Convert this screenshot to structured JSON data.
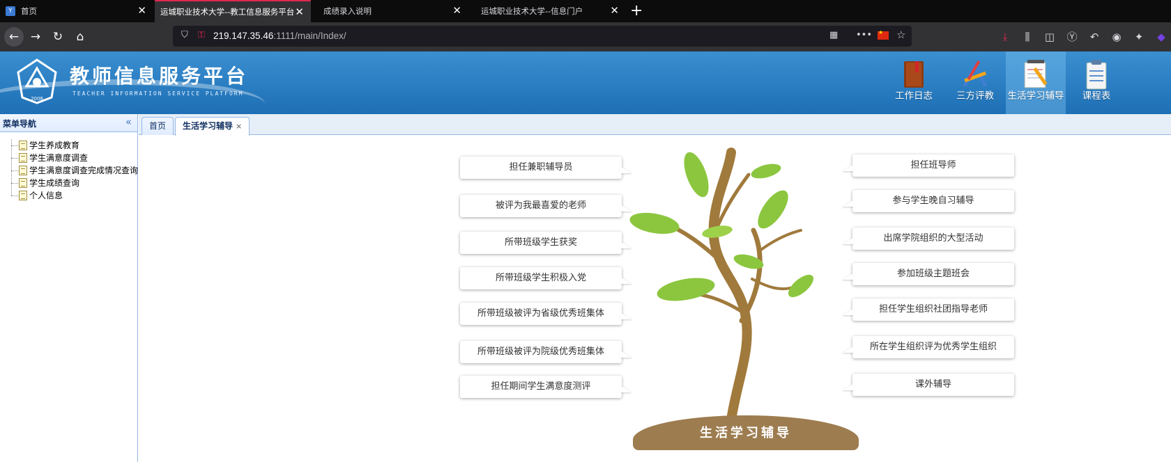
{
  "browser": {
    "tabs": [
      {
        "label": "首页",
        "active": false
      },
      {
        "label": "运城职业技术大学--教工信息服务平台",
        "active": true
      },
      {
        "label": "成绩录入说明",
        "active": false
      },
      {
        "label": "运城职业技术大学--信息门户",
        "active": false
      }
    ],
    "url_host": "219.147.35.46",
    "url_rest": ":1111/main/Index/"
  },
  "header": {
    "title": "教师信息服务平台",
    "subtitle": "TEACHER INFORMATION SERVICE PLATFORM",
    "logo_year": "2006",
    "nav": [
      {
        "label": "工作日志",
        "icon": "book-icon"
      },
      {
        "label": "三方评教",
        "icon": "tools-icon"
      },
      {
        "label": "生活学习辅导",
        "icon": "notepad-icon",
        "active": true
      },
      {
        "label": "课程表",
        "icon": "clipboard-icon"
      }
    ]
  },
  "sidebar": {
    "title": "菜单导航",
    "items": [
      {
        "label": "学生养成教育"
      },
      {
        "label": "学生满意度调查"
      },
      {
        "label": "学生满意度调查完成情况查询"
      },
      {
        "label": "学生成绩查询"
      },
      {
        "label": "个人信息"
      }
    ]
  },
  "tabs": [
    {
      "label": "首页"
    },
    {
      "label": "生活学习辅导",
      "closable": true
    }
  ],
  "content": {
    "left_items": [
      "担任兼职辅导员",
      "被评为我最喜爱的老师",
      "所带班级学生获奖",
      "所带班级学生积极入党",
      "所带班级被评为省级优秀班集体",
      "所带班级被评为院级优秀班集体",
      "担任期间学生满意度测评"
    ],
    "right_items": [
      "担任班导师",
      "参与学生晚自习辅导",
      "出席学院组织的大型活动",
      "参加班级主题班会",
      "担任学生组织社团指导老师",
      "所在学生组织评为优秀学生组织",
      "课外辅导"
    ],
    "ground_label": "生活学习辅导"
  },
  "colors": {
    "header_blue": "#1e6fb5",
    "leaf_green": "#8cc63f",
    "trunk_brown": "#a07a3c",
    "ground_brown": "#9d7c4f"
  }
}
